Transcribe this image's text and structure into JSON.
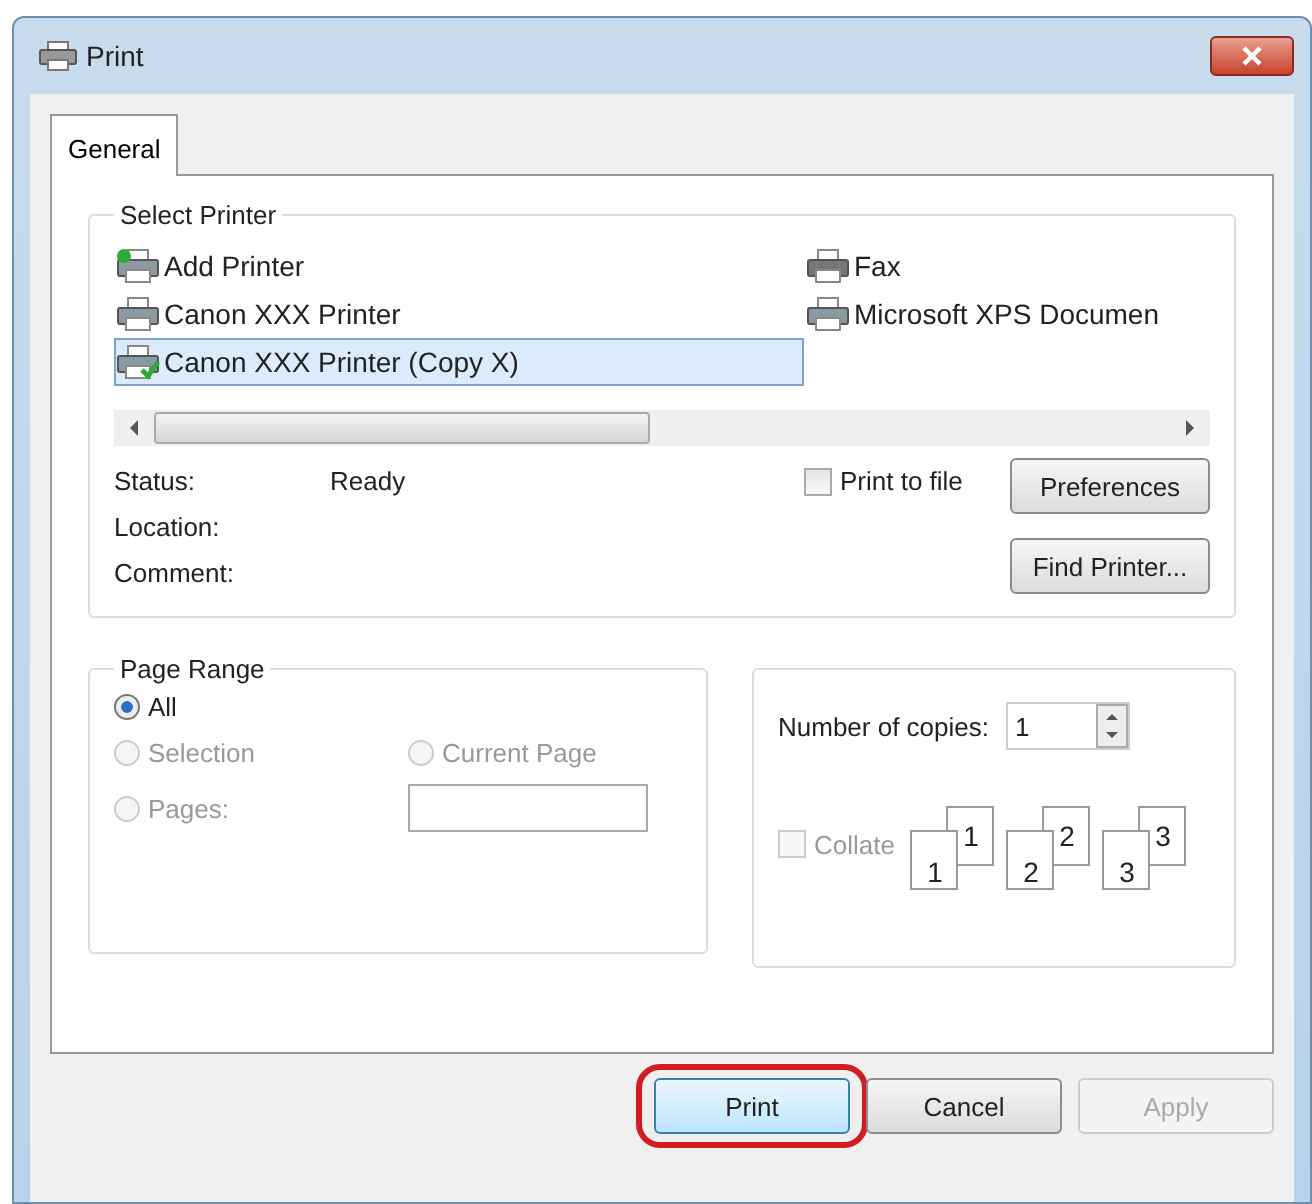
{
  "window": {
    "title": "Print"
  },
  "tabs": [
    {
      "label": "General",
      "selected": true
    }
  ],
  "select_printer": {
    "title": "Select Printer",
    "printers": [
      {
        "name": "Add Printer",
        "kind": "add",
        "selected": false
      },
      {
        "name": "Canon XXX Printer",
        "kind": "printer",
        "selected": false
      },
      {
        "name": "Canon XXX Printer (Copy X)",
        "kind": "default",
        "selected": true
      },
      {
        "name": "Fax",
        "kind": "fax",
        "selected": false
      },
      {
        "name": "Microsoft XPS Documen",
        "kind": "printer",
        "selected": false
      }
    ],
    "info": [
      {
        "label": "Status:",
        "value": "Ready"
      },
      {
        "label": "Location:"
      },
      {
        "label": "Comment:"
      }
    ],
    "print_to_file": {
      "label": "Print to file",
      "checked": false
    },
    "buttons": [
      "Preferences",
      "Find Printer..."
    ]
  },
  "page_range": {
    "title": "Page Range",
    "options": [
      {
        "label": "All",
        "selected": true,
        "disabled": false
      },
      {
        "label": "Selection",
        "selected": false,
        "disabled": true
      },
      {
        "label": "Current Page",
        "selected": false,
        "disabled": true
      },
      {
        "label": "Pages:",
        "selected": false,
        "disabled": true
      }
    ]
  },
  "copies": {
    "label": "Number of copies:",
    "value": "1",
    "collate": {
      "label": "Collate",
      "checked": false,
      "disabled": true
    },
    "pages": [
      {
        "back": "1",
        "front": "1"
      },
      {
        "back": "2",
        "front": "2"
      },
      {
        "back": "3",
        "front": "3"
      }
    ]
  },
  "buttons": [
    {
      "label": "Print",
      "circled": true,
      "disabled": false
    },
    {
      "label": "Cancel",
      "circled": false,
      "disabled": false
    },
    {
      "label": "Apply",
      "circled": false,
      "disabled": true
    }
  ]
}
